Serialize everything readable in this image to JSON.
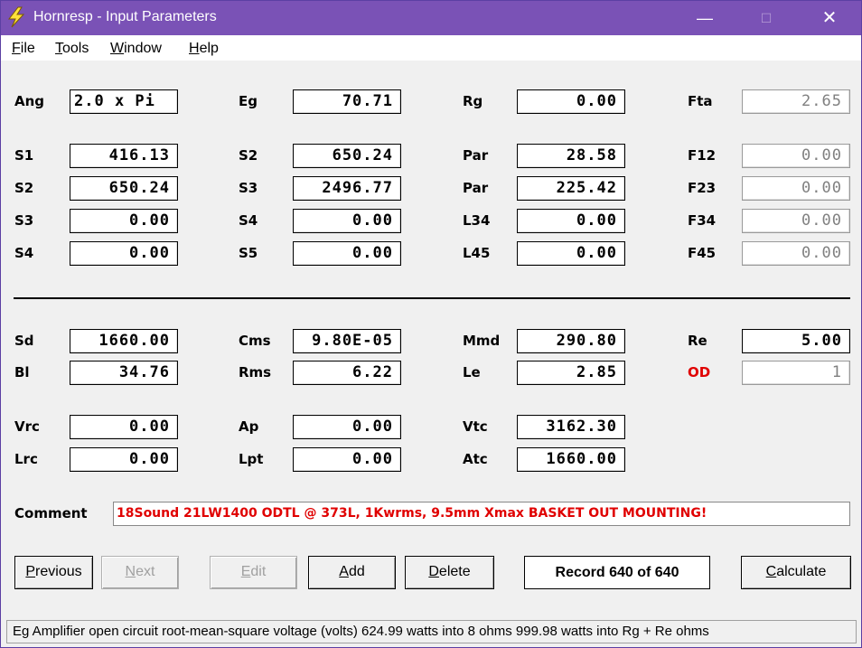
{
  "window": {
    "title": "Hornresp - Input Parameters",
    "controls": {
      "minimize": "—",
      "maximize": "☐",
      "close": "✕"
    },
    "icon": "lightning-icon"
  },
  "menu": [
    {
      "key": "F",
      "rest": "ile"
    },
    {
      "key": "T",
      "rest": "ools"
    },
    {
      "key": "W",
      "rest": "indow"
    },
    {
      "key": "H",
      "rest": "elp"
    }
  ],
  "fields": {
    "ang": {
      "label": "Ang",
      "value": "2.0 x Pi"
    },
    "eg": {
      "label": "Eg",
      "value": "70.71"
    },
    "rg": {
      "label": "Rg",
      "value": "0.00"
    },
    "fta": {
      "label": "Fta",
      "value": "2.65"
    },
    "s1": {
      "label": "S1",
      "value": "416.13"
    },
    "s2a": {
      "label": "S2",
      "value": "650.24"
    },
    "par1": {
      "label": "Par",
      "value": "28.58"
    },
    "f12": {
      "label": "F12",
      "value": "0.00"
    },
    "s2b": {
      "label": "S2",
      "value": "650.24"
    },
    "s3a": {
      "label": "S3",
      "value": "2496.77"
    },
    "par2": {
      "label": "Par",
      "value": "225.42"
    },
    "f23": {
      "label": "F23",
      "value": "0.00"
    },
    "s3b": {
      "label": "S3",
      "value": "0.00"
    },
    "s4a": {
      "label": "S4",
      "value": "0.00"
    },
    "l34": {
      "label": "L34",
      "value": "0.00"
    },
    "f34": {
      "label": "F34",
      "value": "0.00"
    },
    "s4b": {
      "label": "S4",
      "value": "0.00"
    },
    "s5": {
      "label": "S5",
      "value": "0.00"
    },
    "l45": {
      "label": "L45",
      "value": "0.00"
    },
    "f45": {
      "label": "F45",
      "value": "0.00"
    },
    "sd": {
      "label": "Sd",
      "value": "1660.00"
    },
    "cms": {
      "label": "Cms",
      "value": "9.80E-05"
    },
    "mmd": {
      "label": "Mmd",
      "value": "290.80"
    },
    "re": {
      "label": "Re",
      "value": "5.00"
    },
    "bl": {
      "label": "Bl",
      "value": "34.76"
    },
    "rms": {
      "label": "Rms",
      "value": "6.22"
    },
    "le": {
      "label": "Le",
      "value": "2.85"
    },
    "od": {
      "label": "OD",
      "value": "1"
    },
    "vrc": {
      "label": "Vrc",
      "value": "0.00"
    },
    "ap": {
      "label": "Ap",
      "value": "0.00"
    },
    "vtc": {
      "label": "Vtc",
      "value": "3162.30"
    },
    "lrc": {
      "label": "Lrc",
      "value": "0.00"
    },
    "lpt": {
      "label": "Lpt",
      "value": "0.00"
    },
    "atc": {
      "label": "Atc",
      "value": "1660.00"
    }
  },
  "comment": {
    "label": "Comment",
    "value": "18Sound 21LW1400 ODTL @ 373L, 1Kwrms, 9.5mm Xmax BASKET OUT MOUNTING!"
  },
  "buttons": {
    "previous": {
      "key": "P",
      "rest": "revious"
    },
    "next": {
      "key": "N",
      "rest": "ext"
    },
    "edit": {
      "key": "E",
      "rest": "dit"
    },
    "add": {
      "key": "A",
      "rest": "dd"
    },
    "delete": {
      "key": "D",
      "rest": "elete"
    },
    "calculate": {
      "key": "C",
      "rest": "alculate"
    }
  },
  "record": "Record 640 of 640",
  "status": "Eg   Amplifier open circuit root-mean-square voltage  (volts)   624.99 watts into 8 ohms    999.98 watts into Rg + Re ohms",
  "colors": {
    "titlebar": "#7a52b6",
    "comment_text": "#e00000",
    "od_label": "#e00000"
  }
}
